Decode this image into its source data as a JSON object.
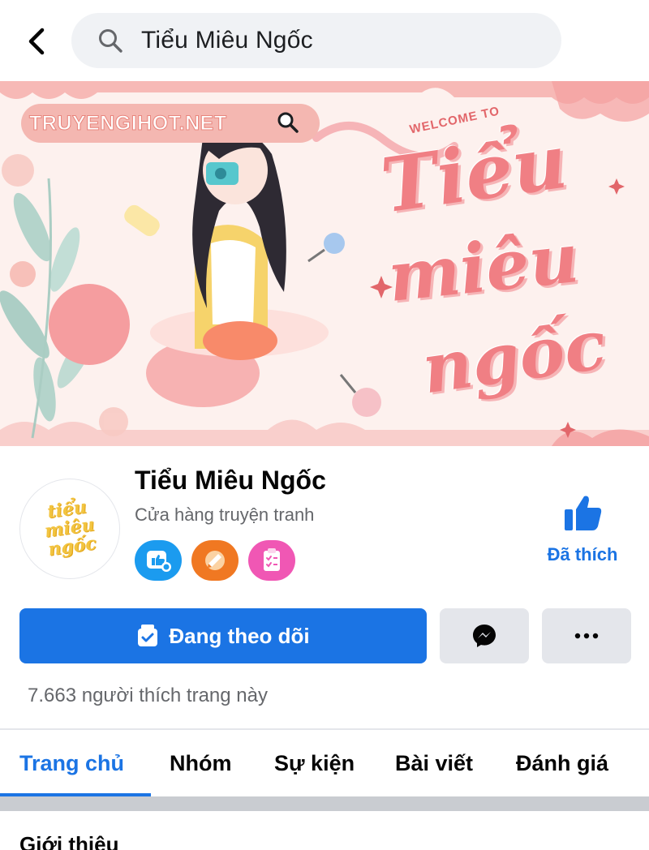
{
  "search": {
    "query": "Tiểu Miêu Ngốc"
  },
  "cover": {
    "site_text": "TRUYENGIHOT.NET",
    "welcome_text": "WELCOME TO",
    "script_line1": "Tiểu",
    "script_line2": "miêu",
    "script_line3": "ngốc"
  },
  "profile": {
    "avatar_line1": "tiểu",
    "avatar_line2": "miêu",
    "avatar_line3": "ngốc",
    "name": "Tiểu Miêu Ngốc",
    "category": "Cửa hàng truyện tranh",
    "liked_label": "Đã thích",
    "badges": [
      {
        "icon": "responsive-badge-icon",
        "color": "#1b9bef"
      },
      {
        "icon": "top-fan-badge-icon",
        "color": "#f07822"
      },
      {
        "icon": "checklist-badge-icon",
        "color": "#f057b4"
      }
    ]
  },
  "actions": {
    "follow_label": "Đang theo dõi",
    "accent": "#1b74e4"
  },
  "stats": {
    "likes_text": "7.663 người thích trang này"
  },
  "tabs": [
    {
      "label": "Trang chủ",
      "active": true
    },
    {
      "label": "Nhóm",
      "active": false
    },
    {
      "label": "Sự kiện",
      "active": false
    },
    {
      "label": "Bài viết",
      "active": false
    },
    {
      "label": "Đánh giá",
      "active": false
    }
  ],
  "intro": {
    "title": "Giới thiệu"
  }
}
